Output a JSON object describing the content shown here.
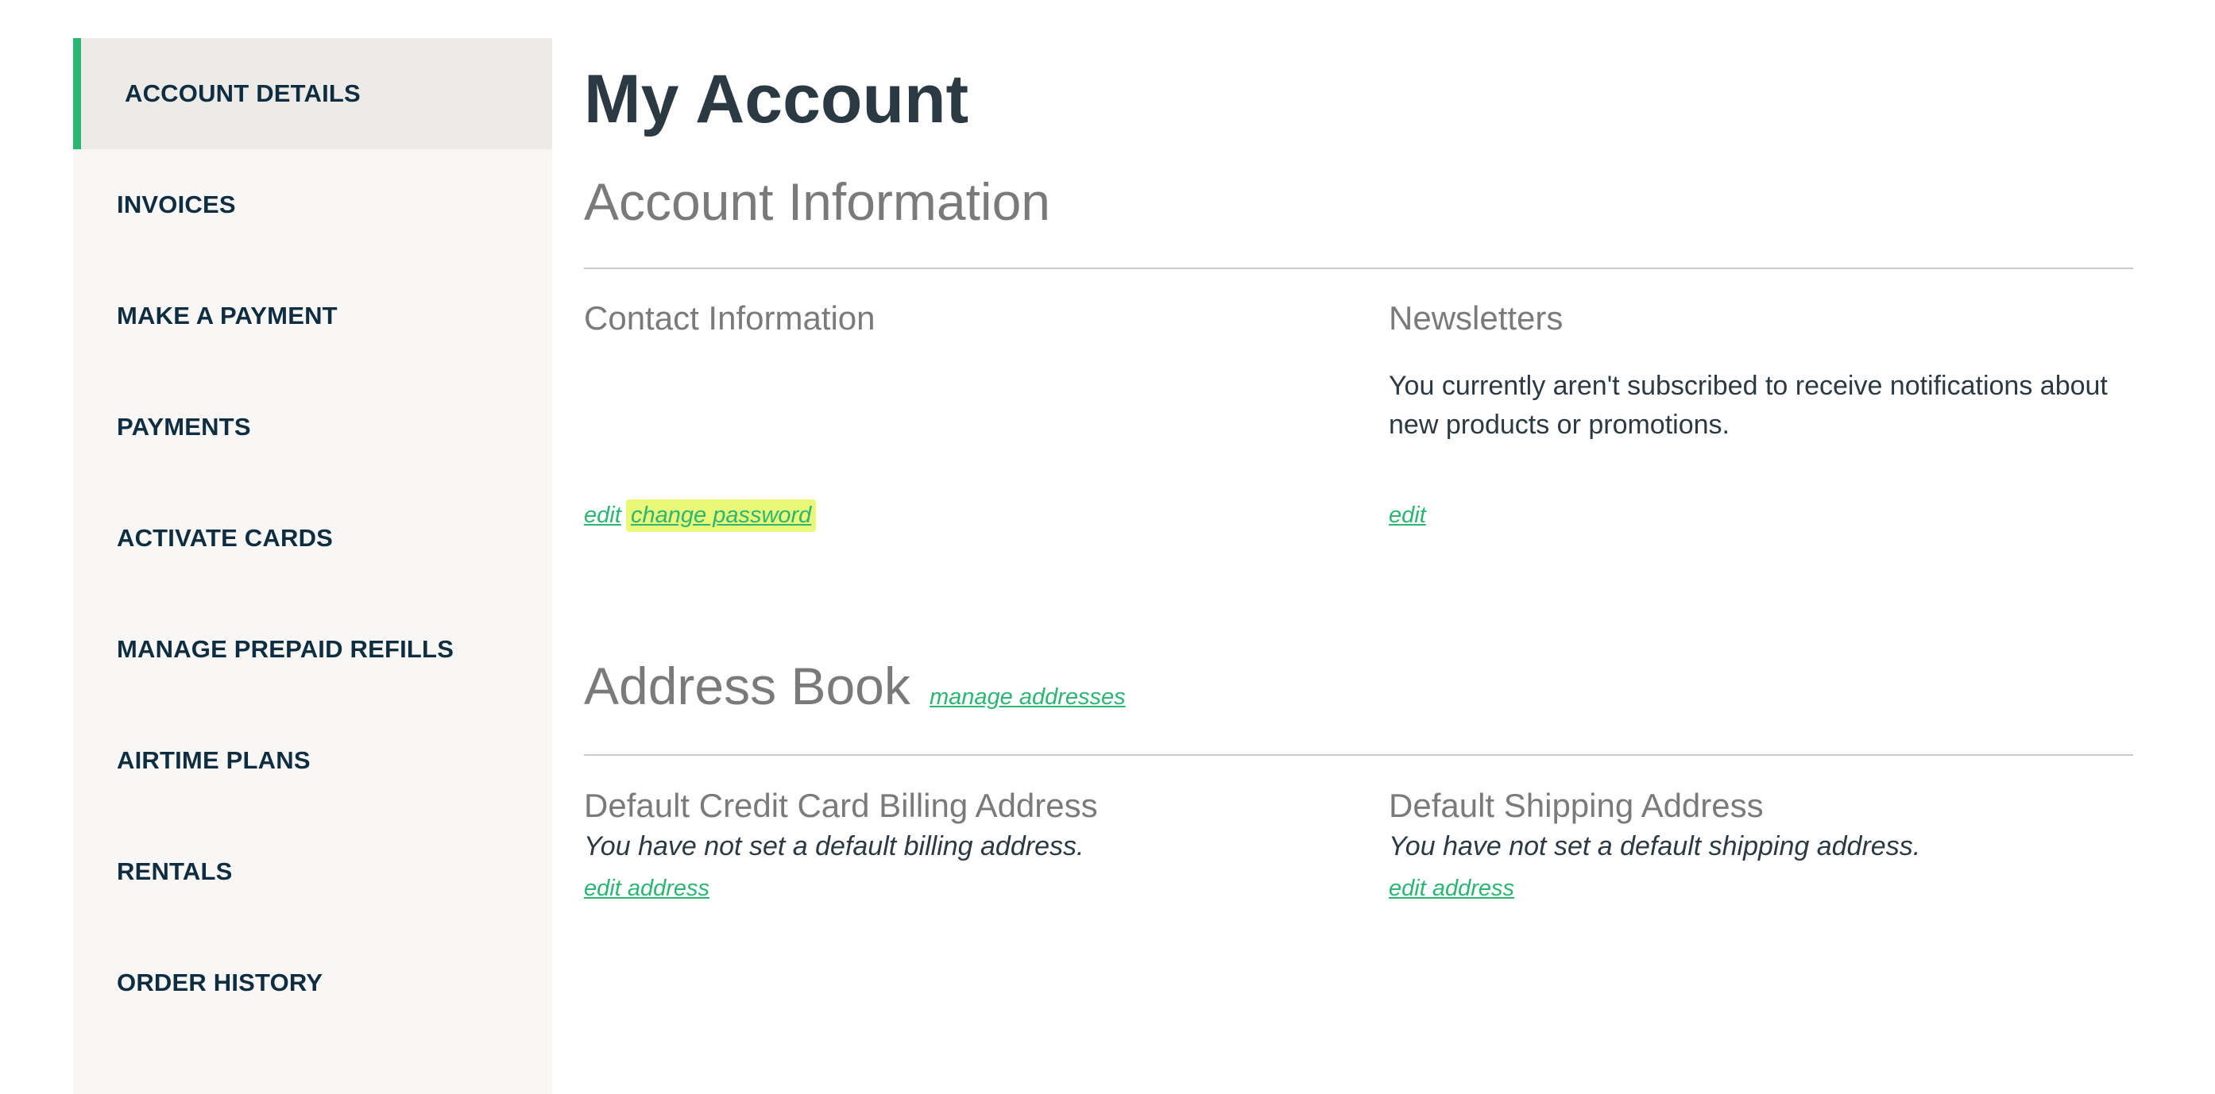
{
  "sidebar": {
    "items": [
      {
        "label": "ACCOUNT DETAILS",
        "active": true
      },
      {
        "label": "INVOICES"
      },
      {
        "label": "MAKE A PAYMENT"
      },
      {
        "label": "PAYMENTS"
      },
      {
        "label": "ACTIVATE CARDS"
      },
      {
        "label": "MANAGE PREPAID REFILLS"
      },
      {
        "label": "AIRTIME PLANS"
      },
      {
        "label": "RENTALS"
      },
      {
        "label": "ORDER HISTORY"
      }
    ]
  },
  "main": {
    "page_title": "My Account",
    "account_information": {
      "title": "Account Information",
      "contact": {
        "title": "Contact Information",
        "edit_link": "edit",
        "change_password_link": "change password"
      },
      "newsletters": {
        "title": "Newsletters",
        "text": "You currently aren't subscribed to receive notifications about new products or promotions.",
        "edit_link": "edit"
      }
    },
    "address_book": {
      "title": "Address Book",
      "manage_link": "manage addresses",
      "billing": {
        "title": "Default Credit Card Billing Address",
        "text": "You have not set a default billing address.",
        "edit_link": "edit address"
      },
      "shipping": {
        "title": "Default Shipping Address",
        "text": "You have not set a default shipping address.",
        "edit_link": "edit address"
      }
    }
  },
  "colors": {
    "accent": "#2bb673",
    "nav_text": "#0f2d40",
    "heading": "#2b3a42",
    "section_heading": "#7a7a7a",
    "sidebar_bg": "#f8f7f5",
    "highlight": "#eaf87a"
  }
}
